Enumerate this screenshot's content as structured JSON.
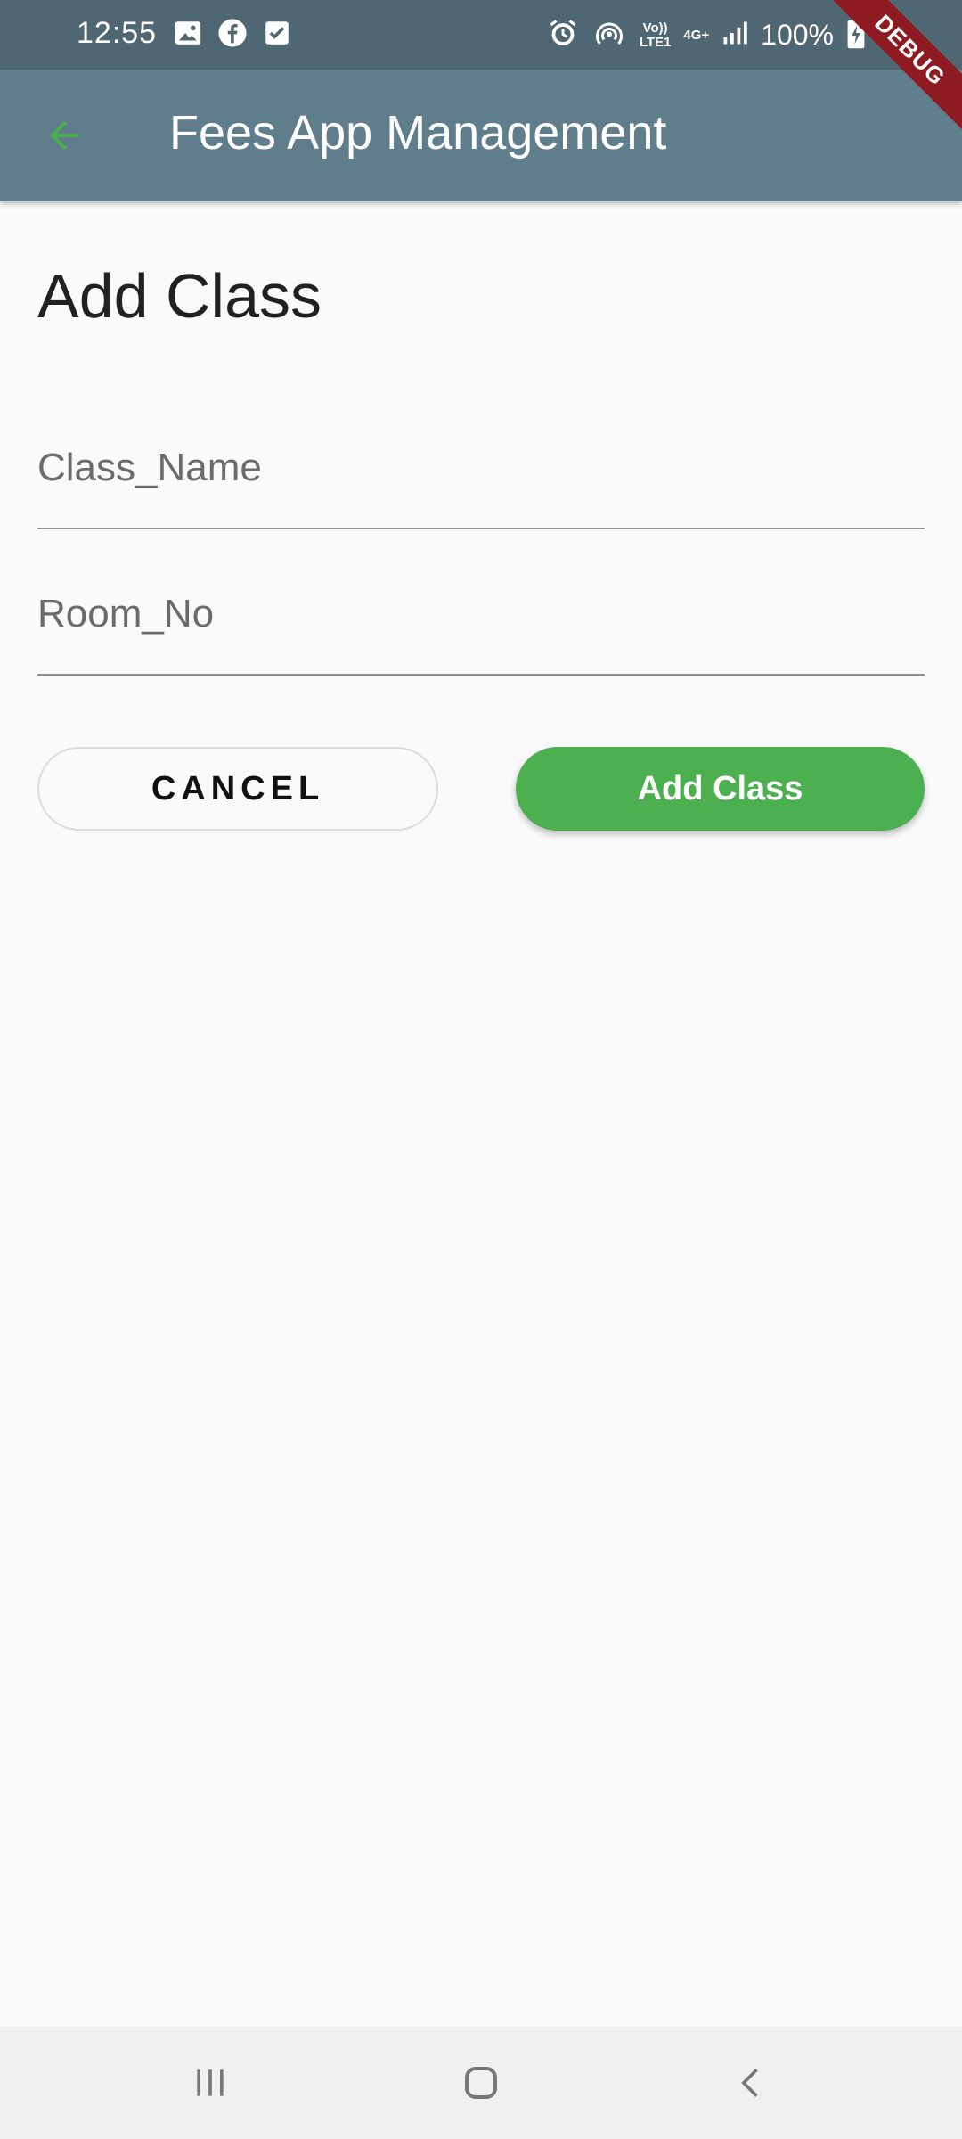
{
  "status_bar": {
    "time": "12:55",
    "left_icons": [
      "image-icon",
      "facebook-icon",
      "check-box-icon"
    ],
    "right_icons": [
      "alarm-icon",
      "hotspot-icon",
      "volte-icon",
      "4g-data-icon",
      "signal-icon",
      "battery-charging-icon"
    ],
    "volte_label": "Vo))\nLTE1",
    "network_label": "4G+",
    "battery_text": "100%"
  },
  "debug_banner": "DEBUG",
  "app_bar": {
    "title": "Fees App Management",
    "back_icon": "arrow-back-icon",
    "accent_color": "#4caf50",
    "background": "#607d8b"
  },
  "page": {
    "heading": "Add Class"
  },
  "form": {
    "class_name_placeholder": "Class_Name",
    "room_no_placeholder": "Room_No"
  },
  "buttons": {
    "cancel_label": "CANCEL",
    "add_label": "Add Class",
    "add_color": "#4caf50"
  },
  "nav_bar": {
    "items": [
      "recent-apps-icon",
      "home-icon",
      "back-icon"
    ]
  }
}
